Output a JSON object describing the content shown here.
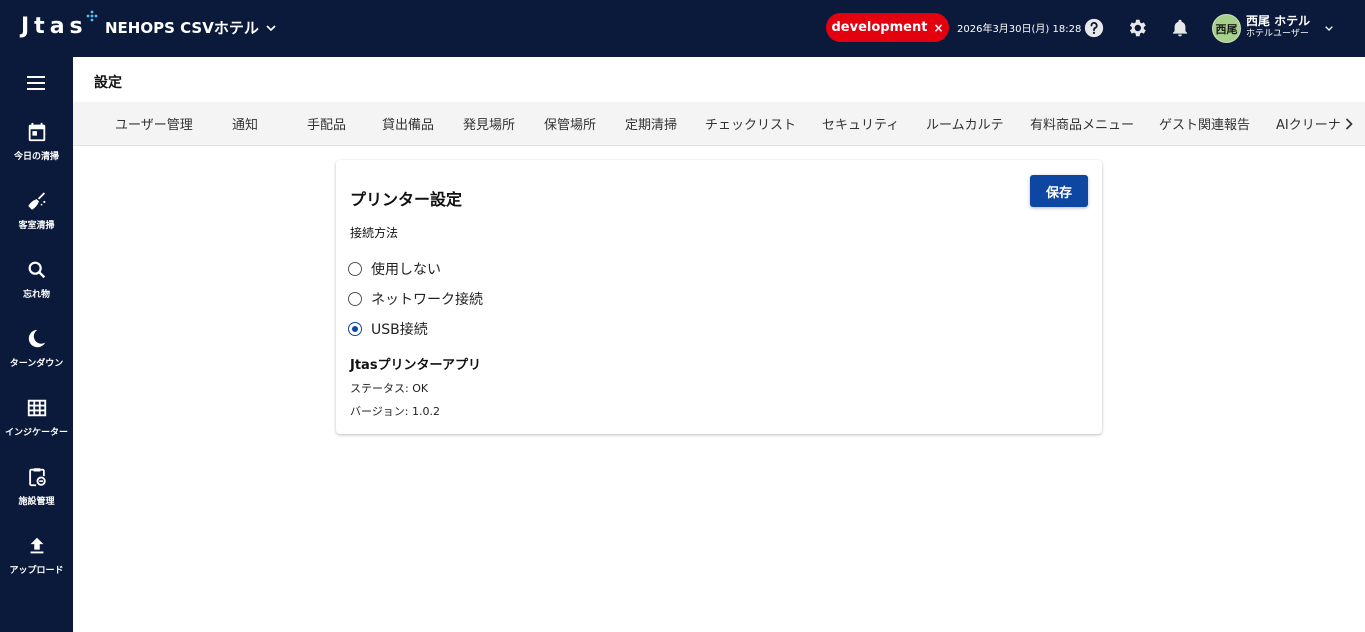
{
  "header": {
    "logo": "Jtas",
    "hotel_name": "NEHOPS CSVホテル",
    "env_label": "development",
    "env_close": "×",
    "datetime": "2026年3月30日(月) 18:28",
    "avatar_text": "西尾",
    "user_name": "西尾 ホテル",
    "user_role": "ホテルユーザー"
  },
  "sidebar": {
    "items": [
      {
        "label": "今日の清掃",
        "icon": "calendar-icon"
      },
      {
        "label": "客室清掃",
        "icon": "broom-icon"
      },
      {
        "label": "忘れ物",
        "icon": "search-icon"
      },
      {
        "label": "ターンダウン",
        "icon": "moon-icon"
      },
      {
        "label": "インジケーター",
        "icon": "grid-icon"
      },
      {
        "label": "施設管理",
        "icon": "clipboard-icon"
      },
      {
        "label": "アップロード",
        "icon": "upload-icon"
      }
    ]
  },
  "page": {
    "title": "設定",
    "tabs": [
      "ユーザー管理",
      "通知",
      "手配品",
      "貸出備品",
      "発見場所",
      "保管場所",
      "定期清掃",
      "チェックリスト",
      "セキュリティ",
      "ルームカルテ",
      "有料商品メニュー",
      "ゲスト関連報告",
      "AIクリーナ"
    ]
  },
  "printer": {
    "title": "プリンター設定",
    "save_label": "保存",
    "connection_label": "接続方法",
    "options": [
      {
        "label": "使用しない",
        "checked": false
      },
      {
        "label": "ネットワーク接続",
        "checked": false
      },
      {
        "label": "USB接続",
        "checked": true
      }
    ],
    "app_title": "Jtasプリンターアプリ",
    "status_text": "ステータス: OK",
    "version_text": "バージョン: 1.0.2"
  },
  "colors": {
    "nav_bg": "#0b1a3a",
    "env_badge": "#e3000f",
    "primary": "#0d47a1",
    "logo_accent": "#4fc3f7"
  }
}
